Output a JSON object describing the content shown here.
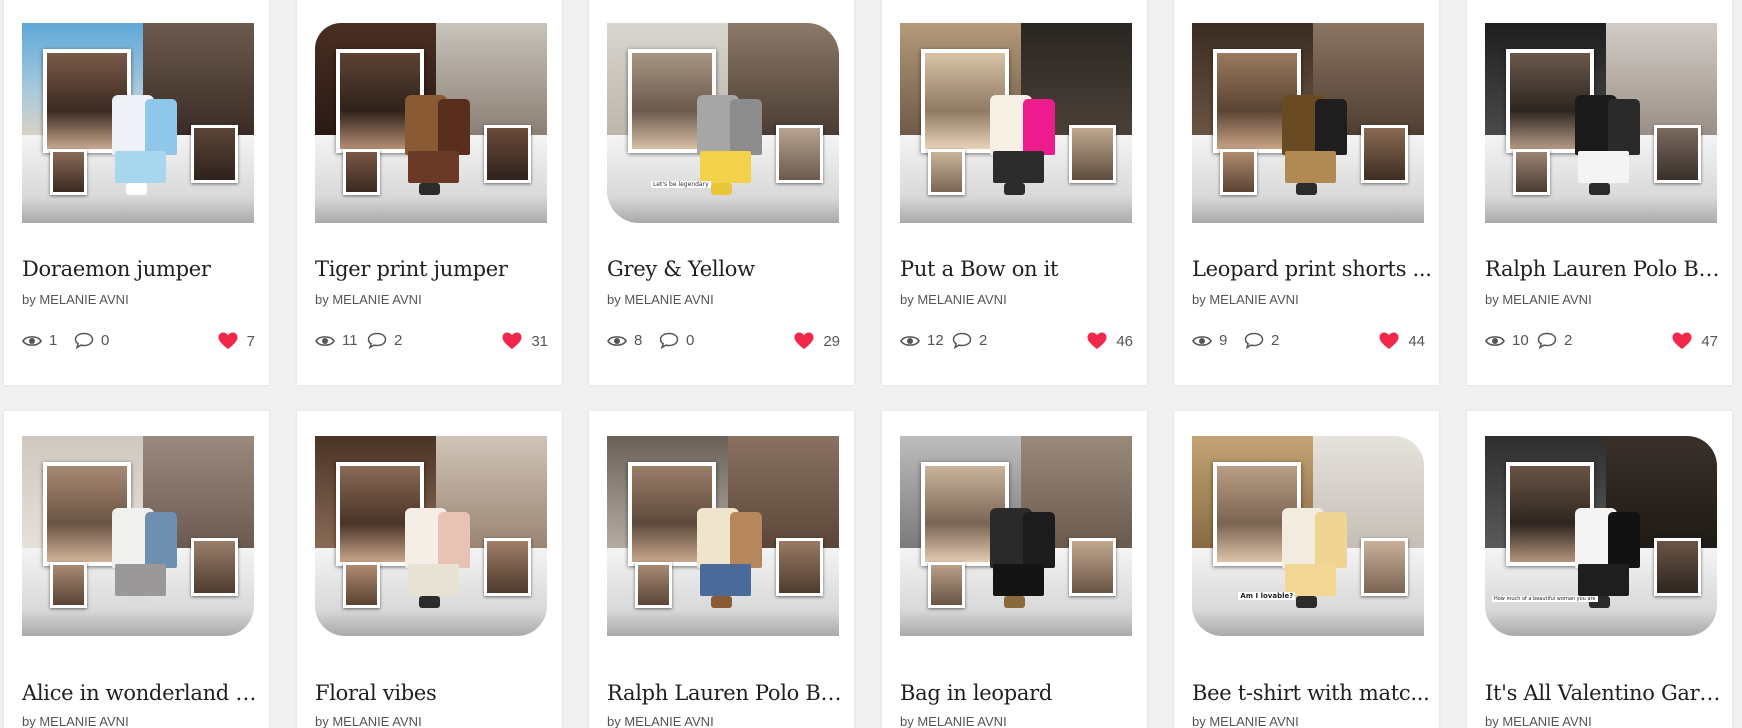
{
  "colors": {
    "heart": "#f0284a",
    "text_dark": "#1f1f1f",
    "text_muted": "#555555",
    "card_bg": "#ffffff",
    "page_bg": "#f1f1f1"
  },
  "icons": {
    "views": "eye-icon",
    "comments": "speech-bubble-icon",
    "likes": "heart-icon"
  },
  "sets": [
    {
      "title": "Doraemon jumper",
      "author": "by MELANIE AVNI",
      "views": "1",
      "comments": "0",
      "likes": "7"
    },
    {
      "title": "Tiger print jumper",
      "author": "by MELANIE AVNI",
      "views": "11",
      "comments": "2",
      "likes": "31"
    },
    {
      "title": "Grey & Yellow",
      "author": "by MELANIE AVNI",
      "views": "8",
      "comments": "0",
      "likes": "29",
      "collage_caption": "Let's be legendary"
    },
    {
      "title": "Put a Bow on it",
      "author": "by MELANIE AVNI",
      "views": "12",
      "comments": "2",
      "likes": "46"
    },
    {
      "title": "Leopard print shorts ...",
      "author": "by MELANIE AVNI",
      "views": "9",
      "comments": "2",
      "likes": "44"
    },
    {
      "title": "Ralph Lauren Polo Be...",
      "author": "by MELANIE AVNI",
      "views": "10",
      "comments": "2",
      "likes": "47"
    },
    {
      "title": "Alice in wonderland c...",
      "author": "by MELANIE AVNI"
    },
    {
      "title": "Floral vibes",
      "author": "by MELANIE AVNI"
    },
    {
      "title": "Ralph Lauren Polo Be...",
      "author": "by MELANIE AVNI"
    },
    {
      "title": "Bag in leopard",
      "author": "by MELANIE AVNI"
    },
    {
      "title": "Bee t-shirt with matc...",
      "author": "by MELANIE AVNI",
      "collage_caption": "Am I lovable?"
    },
    {
      "title": "It's All Valentino Gara...",
      "author": "by MELANIE AVNI",
      "collage_caption": "How much of a beautiful woman you are"
    }
  ]
}
